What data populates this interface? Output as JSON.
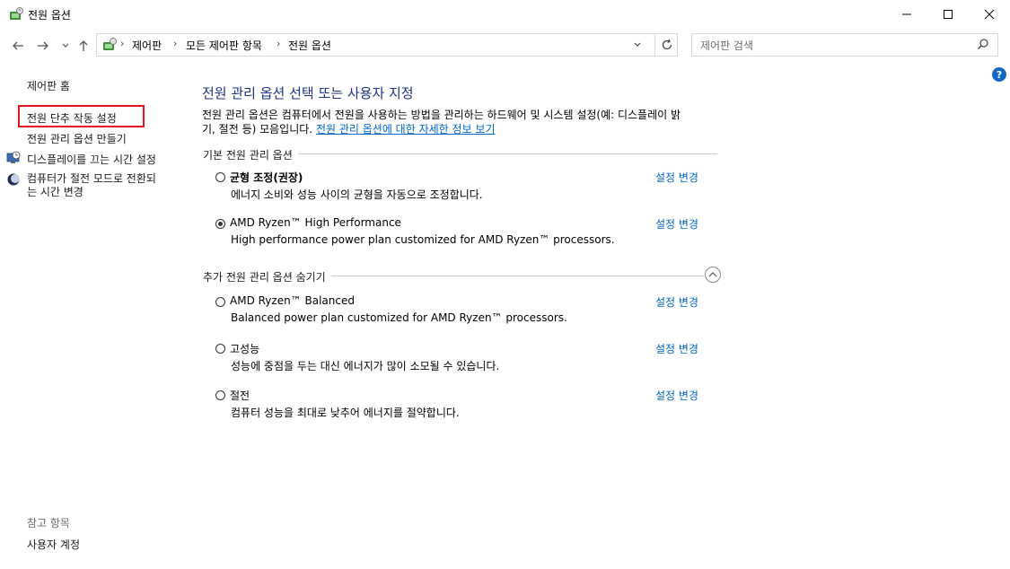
{
  "window": {
    "title": "전원 옵션"
  },
  "address": {
    "breadcrumbs": [
      "제어판",
      "모든 제어판 항목",
      "전원 옵션"
    ],
    "search_placeholder": "제어판 검색"
  },
  "left_pane": {
    "home": "제어판 홈",
    "links": [
      "전원 단추 작동 설정",
      "전원 관리 옵션 만들기",
      "디스플레이를 끄는 시간 설정",
      "컴퓨터가 절전 모드로 전환되는 시간 변경"
    ],
    "link_multiline": [
      "컴퓨터가 절전 모드로 전환되",
      "는 시간 변경"
    ],
    "see_also_label": "참고 항목",
    "see_also_items": [
      "사용자 계정"
    ]
  },
  "main": {
    "title": "전원 관리 옵션 선택 또는 사용자 지정",
    "description_line1": "전원 관리 옵션은 컴퓨터에서 전원을 사용하는 방법을 관리하는 하드웨어 및 시스템 설정(예: 디스플레이 밝",
    "description_line2": "기, 절전 등) 모음입니다.",
    "more_info_link": "전원 관리 옵션에 대한 자세한 정보 보기",
    "preferred_group_label": "기본 전원 관리 옵션",
    "additional_group_label": "추가 전원 관리 옵션 숨기기",
    "change_link": "설정 변경",
    "plans_preferred": [
      {
        "name": "균형 조정(권장)",
        "description": "에너지 소비와 성능 사이의 균형을 자동으로 조정합니다.",
        "selected": false
      },
      {
        "name": "AMD Ryzen™ High Performance",
        "description": "High performance power plan customized for AMD Ryzen™ processors.",
        "selected": true
      }
    ],
    "plans_additional": [
      {
        "name": "AMD Ryzen™ Balanced",
        "description": "Balanced power plan customized for AMD Ryzen™ processors.",
        "selected": false
      },
      {
        "name": "고성능",
        "description": "성능에 중점을 두는 대신 에너지가 많이 소모될 수 있습니다.",
        "selected": false
      },
      {
        "name": "절전",
        "description": "컴퓨터 성능을 최대로 낮추어 에너지를 절약합니다.",
        "selected": false
      }
    ]
  },
  "icons": {
    "title": "power-options-icon",
    "back": "back-arrow-icon",
    "forward": "forward-arrow-icon",
    "recent": "chevron-down-icon",
    "up": "up-arrow-icon",
    "refresh": "refresh-icon",
    "search": "search-icon",
    "help": "help-icon"
  },
  "colors": {
    "link": "#0066cc",
    "heading": "#1e3287",
    "highlight_box": "#e81123",
    "help": "#1266c4"
  }
}
